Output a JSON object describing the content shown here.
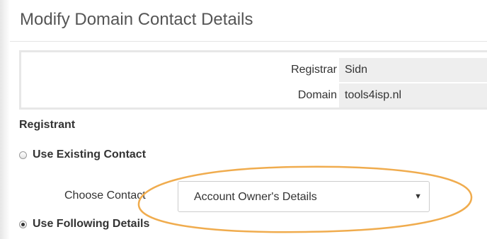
{
  "page": {
    "title": "Modify Domain Contact Details"
  },
  "info": {
    "registrar_label": "Registrar",
    "registrar_value": "Sidn",
    "domain_label": "Domain",
    "domain_value": "tools4isp.nl"
  },
  "registrant": {
    "section_label": "Registrant",
    "use_existing_label": "Use Existing Contact",
    "use_existing_checked": false,
    "choose_contact_label": "Choose Contact",
    "choose_contact_value": "Account Owner's Details",
    "use_following_label": "Use Following Details",
    "use_following_checked": true
  },
  "annotation": {
    "color": "#f0ac4e"
  },
  "icons": {
    "dropdown": "triangle-down-icon"
  }
}
